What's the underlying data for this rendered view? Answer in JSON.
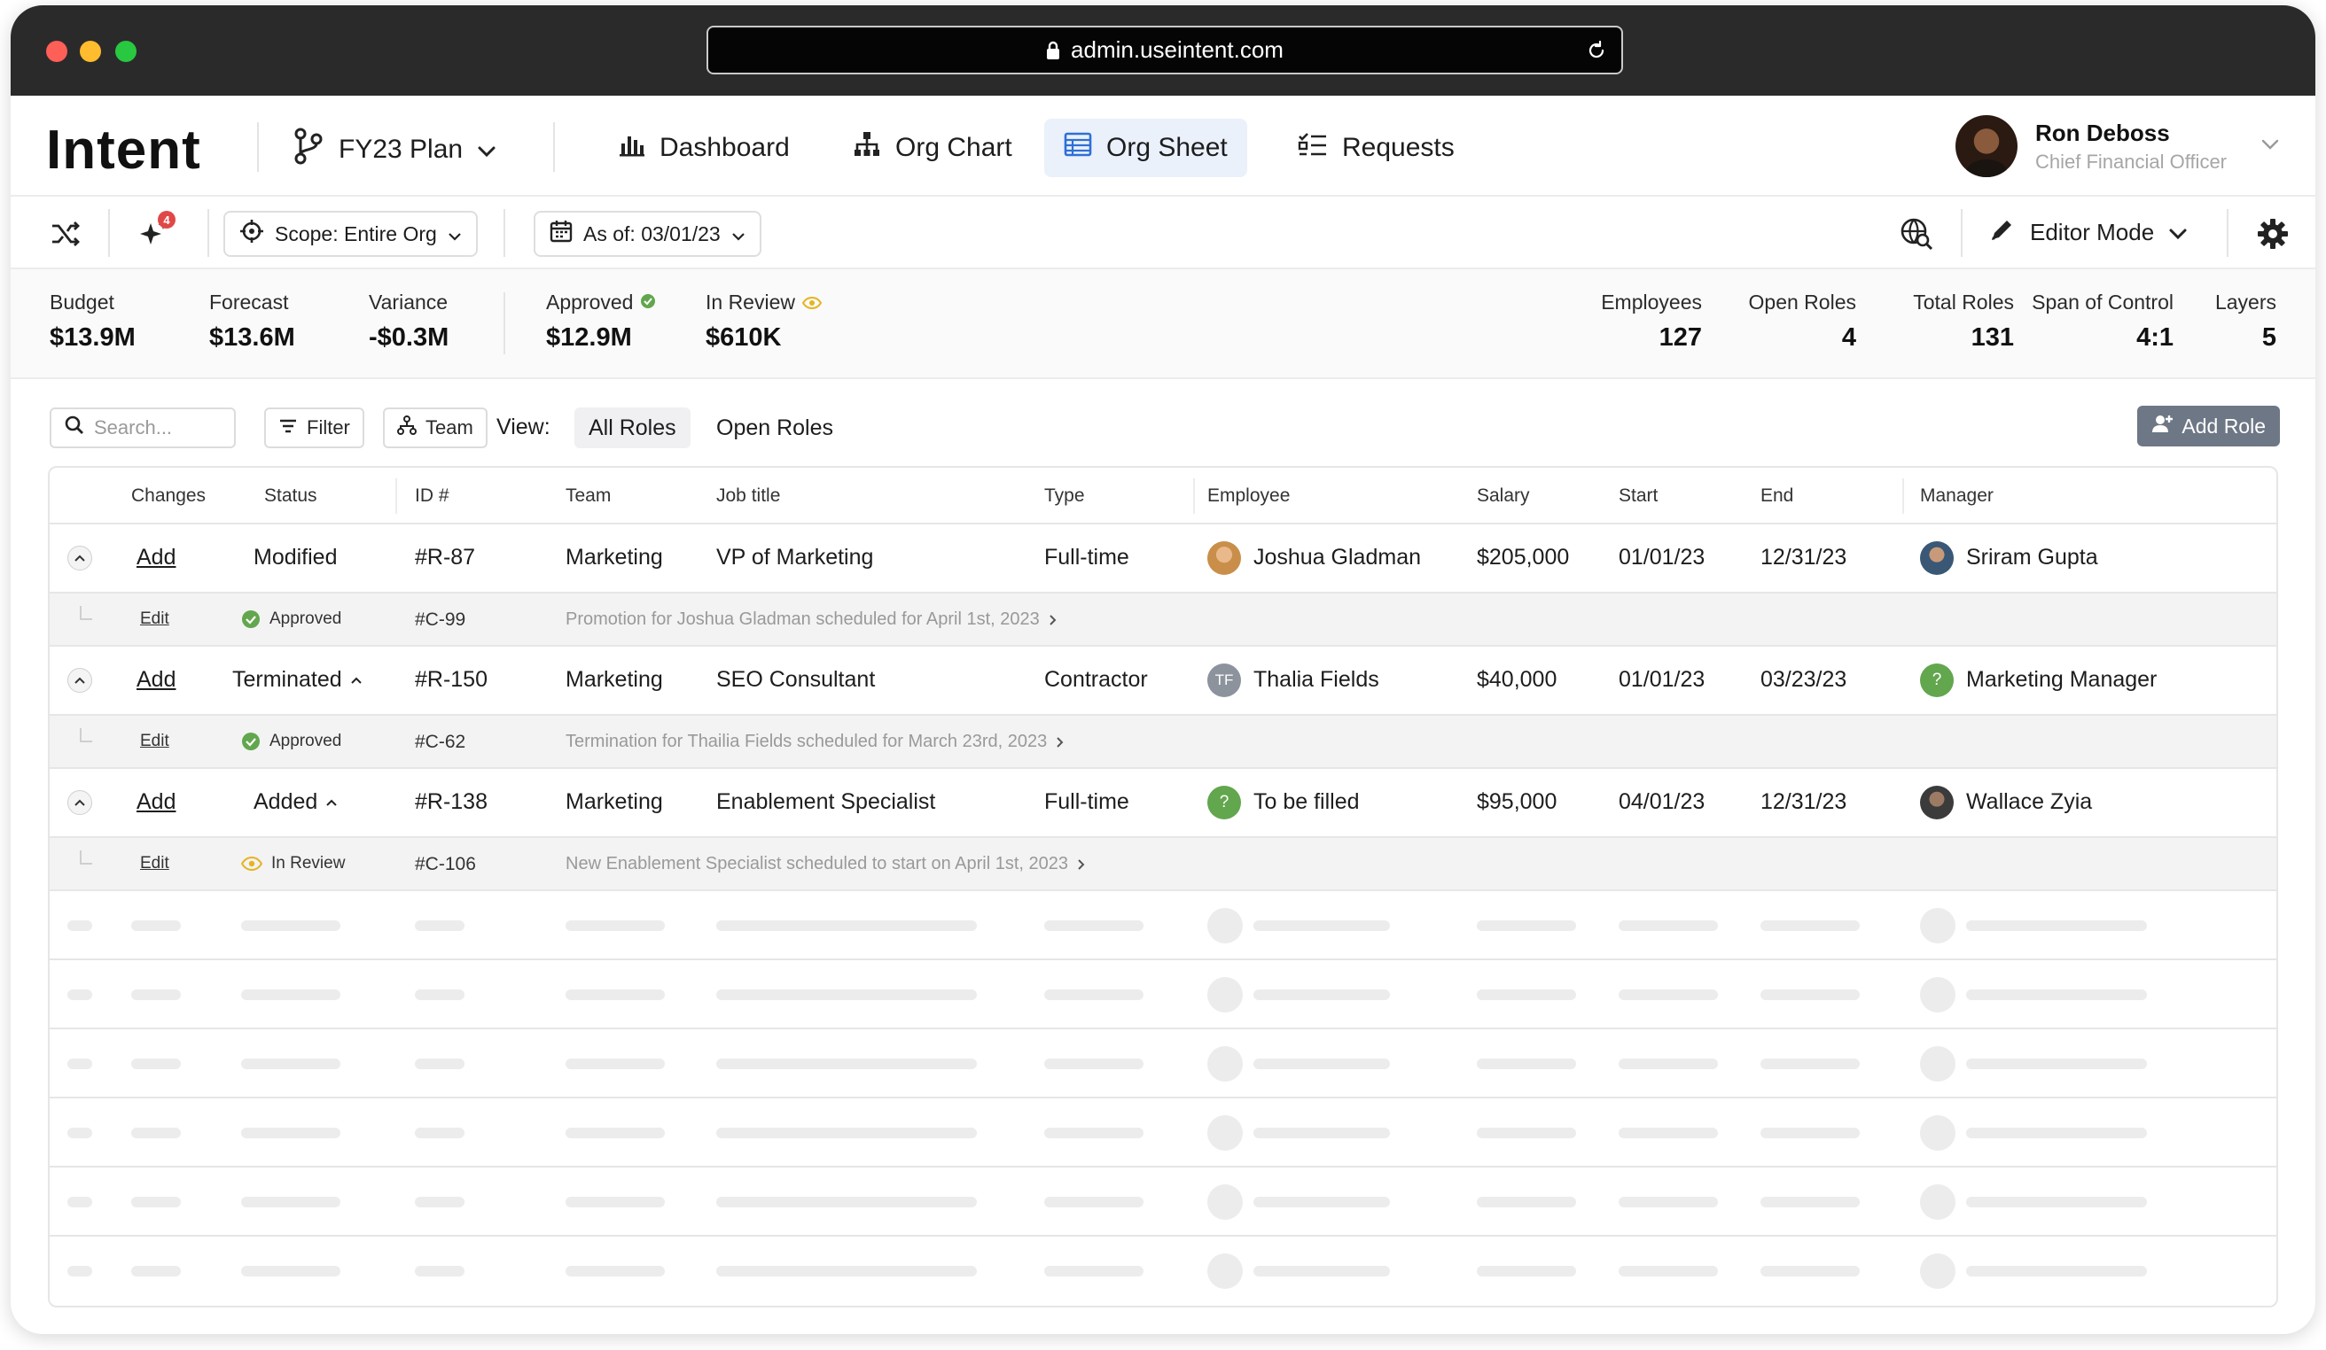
{
  "browser": {
    "url": "admin.useintent.com"
  },
  "app": {
    "logo": "Intent"
  },
  "plan": {
    "label": "FY23 Plan"
  },
  "nav": {
    "dashboard": "Dashboard",
    "org_chart": "Org Chart",
    "org_sheet": "Org Sheet",
    "requests": "Requests",
    "active": "Org Sheet"
  },
  "user": {
    "name": "Ron Deboss",
    "role": "Chief Financial Officer"
  },
  "toolbar": {
    "notification_count": "4",
    "scope_label": "Scope: Entire Org",
    "asof_label": "As of: 03/01/23",
    "editor_mode": "Editor Mode"
  },
  "metrics": {
    "budget": {
      "label": "Budget",
      "value": "$13.9M"
    },
    "forecast": {
      "label": "Forecast",
      "value": "$13.6M"
    },
    "variance": {
      "label": "Variance",
      "value": "-$0.3M"
    },
    "approved": {
      "label": "Approved",
      "value": "$12.9M"
    },
    "in_review": {
      "label": "In Review",
      "value": "$610K"
    },
    "employees": {
      "label": "Employees",
      "value": "127"
    },
    "open_roles": {
      "label": "Open Roles",
      "value": "4"
    },
    "total_roles": {
      "label": "Total Roles",
      "value": "131"
    },
    "span": {
      "label": "Span of Control",
      "value": "4:1"
    },
    "layers": {
      "label": "Layers",
      "value": "5"
    }
  },
  "filters": {
    "search_placeholder": "Search...",
    "filter_label": "Filter",
    "team_label": "Team",
    "view_label": "View:",
    "view_all": "All Roles",
    "view_open": "Open Roles",
    "add_role": "Add Role"
  },
  "table": {
    "headers": [
      "Changes",
      "Status",
      "ID #",
      "Team",
      "Job title",
      "Type",
      "Employee",
      "Salary",
      "Start",
      "End",
      "Manager"
    ],
    "rows": [
      {
        "change": "Add",
        "status": "Modified",
        "id": "#R-87",
        "team": "Marketing",
        "title": "VP of Marketing",
        "type": "Full-time",
        "employee": "Joshua Gladman",
        "salary": "$205,000",
        "start": "01/01/23",
        "end": "12/31/23",
        "manager": "Sriram Gupta",
        "sub": {
          "action": "Edit",
          "status": "Approved",
          "id": "#C-99",
          "note": "Promotion for Joshua Gladman scheduled for April 1st, 2023"
        }
      },
      {
        "change": "Add",
        "status": "Terminated",
        "id": "#R-150",
        "team": "Marketing",
        "title": "SEO Consultant",
        "type": "Contractor",
        "employee_initials": "TF",
        "employee": "Thalia Fields",
        "salary": "$40,000",
        "start": "01/01/23",
        "end": "03/23/23",
        "manager": "Marketing Manager",
        "sub": {
          "action": "Edit",
          "status": "Approved",
          "id": "#C-62",
          "note": "Termination for Thailia Fields scheduled for March 23rd, 2023"
        }
      },
      {
        "change": "Add",
        "status": "Added",
        "id": "#R-138",
        "team": "Marketing",
        "title": "Enablement Specialist",
        "type": "Full-time",
        "employee": "To be filled",
        "salary": "$95,000",
        "start": "04/01/23",
        "end": "12/31/23",
        "manager": "Wallace Zyia",
        "sub": {
          "action": "Edit",
          "status": "In Review",
          "id": "#C-106",
          "note": "New Enablement Specialist scheduled to start on April 1st, 2023"
        }
      }
    ],
    "placeholder_glyph": "?"
  },
  "colors": {
    "accent": "#3c79d8",
    "approved": "#62a64e",
    "review": "#e6b422",
    "active_tab_bg": "#eaf1fb",
    "button_dark": "#6e7785"
  }
}
